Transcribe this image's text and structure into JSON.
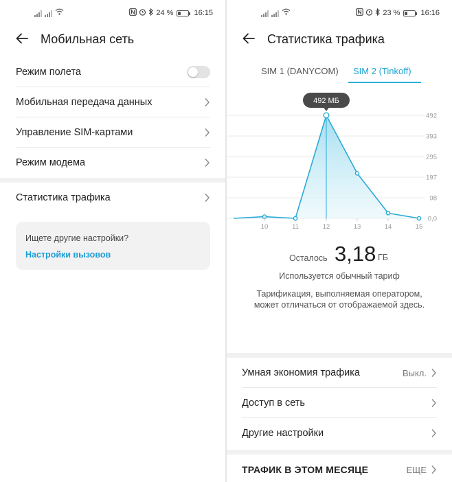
{
  "left_screen": {
    "status": {
      "battery": "24 %",
      "time": "16:15"
    },
    "title": "Мобильная сеть",
    "rows": [
      {
        "label": "Режим полета"
      },
      {
        "label": "Мобильная передача данных"
      },
      {
        "label": "Управление SIM-картами"
      },
      {
        "label": "Режим модема"
      },
      {
        "label": "Статистика трафика"
      }
    ],
    "hint": {
      "question": "Ищете другие настройки?",
      "link": "Настройки вызовов"
    }
  },
  "right_screen": {
    "status": {
      "battery": "23 %",
      "time": "16:16"
    },
    "title": "Статистика трафика",
    "tabs": [
      {
        "label": "SIM 1 (DANYCOM)",
        "active": false
      },
      {
        "label": "SIM 2 (Tinkoff)",
        "active": true
      }
    ],
    "tooltip": "492 МБ",
    "remaining": {
      "label": "Осталось",
      "value": "3,18",
      "unit": "ГБ"
    },
    "plan": "Используется обычный тариф",
    "note_lines": [
      "Тарификация, выполняемая оператором,",
      "может отличаться от отображаемой здесь."
    ],
    "rows": [
      {
        "label": "Умная экономия трафика",
        "value": "Выкл."
      },
      {
        "label": "Доступ в сеть"
      },
      {
        "label": "Другие настройки"
      },
      {
        "label": "ТРАФИК В ЭТОМ МЕСЯЦЕ",
        "value": "ЕЩЕ"
      }
    ]
  },
  "chart_data": {
    "type": "area",
    "x": [
      9,
      10,
      11,
      12,
      13,
      14,
      15
    ],
    "x_tick_labels": [
      "10",
      "11",
      "12",
      "13",
      "14",
      "15"
    ],
    "series": [
      {
        "values": [
          0,
          8,
          0,
          492,
          215,
          25,
          0
        ]
      }
    ],
    "y_tick_labels": [
      "492",
      "393",
      "295",
      "197",
      "98",
      "0,0"
    ],
    "y_ticks": [
      492,
      393,
      295,
      197,
      98,
      0
    ],
    "ylim": [
      0,
      492
    ],
    "highlight_x": 12,
    "grid": true,
    "colors": {
      "line": "#29abd6",
      "fill_top": "#9fdcef",
      "fill_bottom": "#e6f6fb"
    }
  }
}
